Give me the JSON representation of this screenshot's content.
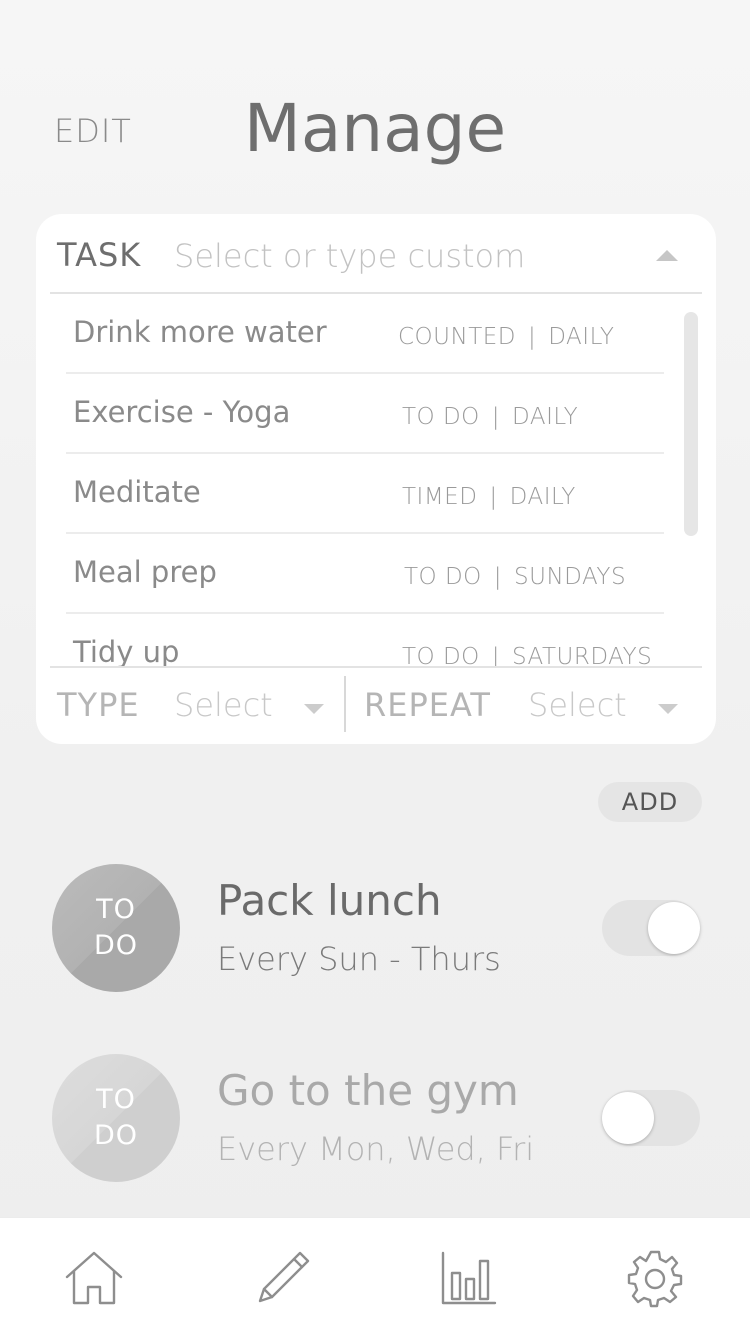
{
  "header": {
    "edit_label": "EDIT",
    "title": "Manage"
  },
  "task_picker": {
    "task_label": "TASK",
    "placeholder": "Select or type custom",
    "options": [
      {
        "name": "Drink more water",
        "type": "COUNTED",
        "repeat": "DAILY"
      },
      {
        "name": "Exercise - Yoga",
        "type": "TO DO",
        "repeat": "DAILY"
      },
      {
        "name": "Meditate",
        "type": "TIMED",
        "repeat": "DAILY"
      },
      {
        "name": "Meal prep",
        "type": "TO DO",
        "repeat": "SUNDAYS"
      },
      {
        "name": "Tidy up",
        "type": "TO DO",
        "repeat": "SATURDAYS"
      }
    ],
    "type_label": "TYPE",
    "type_value": "Select",
    "repeat_label": "REPEAT",
    "repeat_value": "Select"
  },
  "add_label": "ADD",
  "habits": [
    {
      "badge_line1": "TO",
      "badge_line2": "DO",
      "name": "Pack lunch",
      "schedule": "Every Sun - Thurs",
      "enabled": true
    },
    {
      "badge_line1": "TO",
      "badge_line2": "DO",
      "name": "Go to the gym",
      "schedule": "Every Mon, Wed, Fri",
      "enabled": false
    }
  ],
  "tabbar": {
    "tabs": [
      {
        "icon": "home-icon"
      },
      {
        "icon": "pencil-icon"
      },
      {
        "icon": "bar-chart-icon"
      },
      {
        "icon": "gear-icon"
      }
    ],
    "active_tab_index": 1
  },
  "colors": {
    "background": "#f2f2f2",
    "card": "#ffffff",
    "toggle_track": "#e3e3e3",
    "badge_active": "#b2b2b2",
    "badge_inactive": "#d6d6d6"
  }
}
